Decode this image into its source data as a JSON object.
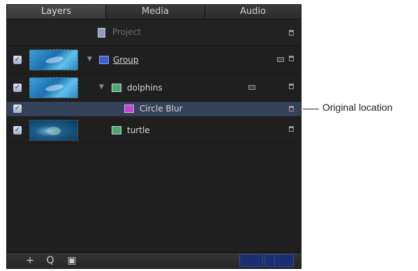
{
  "tabs": [
    {
      "label": "Layers",
      "active": true
    },
    {
      "label": "Media",
      "active": false
    },
    {
      "label": "Audio",
      "active": false
    }
  ],
  "rows": {
    "project": {
      "label": "Project"
    },
    "group": {
      "label": "Group",
      "checked": true
    },
    "dolphins": {
      "label": "dolphins",
      "checked": true
    },
    "circle_blur": {
      "label": "Circle Blur",
      "checked": true
    },
    "turtle": {
      "label": "turtle",
      "checked": true
    }
  },
  "bottom_bar": {
    "add": "+",
    "search": "Q",
    "window": "▣"
  },
  "callout": {
    "text": "Original location"
  },
  "colors": {
    "selected_row": "#34425a",
    "accent": "#2e4aa8"
  }
}
